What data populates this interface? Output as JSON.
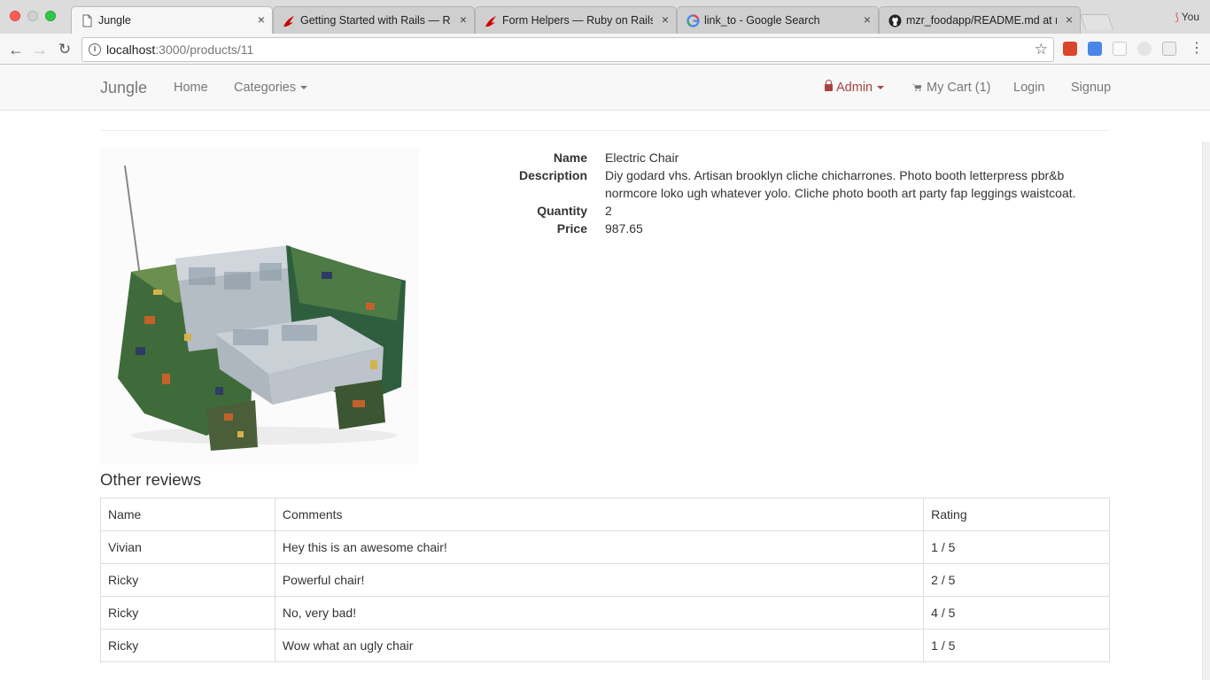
{
  "browser": {
    "tabs": [
      {
        "title": "Jungle",
        "favicon": "page-icon",
        "active": true
      },
      {
        "title": "Getting Started with Rails — Ruby on Rails Guides",
        "favicon": "rails-icon",
        "active": false
      },
      {
        "title": "Form Helpers — Ruby on Rails Guides",
        "favicon": "rails-icon",
        "active": false
      },
      {
        "title": "link_to - Google Search",
        "favicon": "google-icon",
        "active": false
      },
      {
        "title": "mzr_foodapp/README.md at master",
        "favicon": "github-icon",
        "active": false
      }
    ],
    "close_glyph": "×",
    "profile_label": "You",
    "url_host": "localhost",
    "url_rest": ":3000/products/11"
  },
  "navbar": {
    "brand": "Jungle",
    "home": "Home",
    "categories": "Categories",
    "admin": "Admin",
    "cart": "My Cart (1)",
    "login": "Login",
    "signup": "Signup"
  },
  "product": {
    "fields": [
      {
        "label": "Name",
        "value": "Electric Chair"
      },
      {
        "label": "Description",
        "value": "Diy godard vhs. Artisan brooklyn cliche chicharrones. Photo booth letterpress pbr&b normcore loko ugh whatever yolo. Cliche photo booth art party fap leggings waistcoat."
      },
      {
        "label": "Quantity",
        "value": "2"
      },
      {
        "label": "Price",
        "value": "987.65"
      }
    ]
  },
  "reviews": {
    "title": "Other reviews",
    "headers": [
      "Name",
      "Comments",
      "Rating"
    ],
    "rows": [
      [
        "Vivian",
        "Hey this is an awesome chair!",
        "1 / 5"
      ],
      [
        "Ricky",
        "Powerful chair!",
        "2 / 5"
      ],
      [
        "Ricky",
        "No, very bad!",
        "4 / 5"
      ],
      [
        "Ricky",
        "Wow what an ugly chair",
        "1 / 5"
      ]
    ]
  },
  "colors": {
    "admin": "#a94442",
    "nav_text": "#777777",
    "navbar_bg": "#f8f8f8"
  }
}
